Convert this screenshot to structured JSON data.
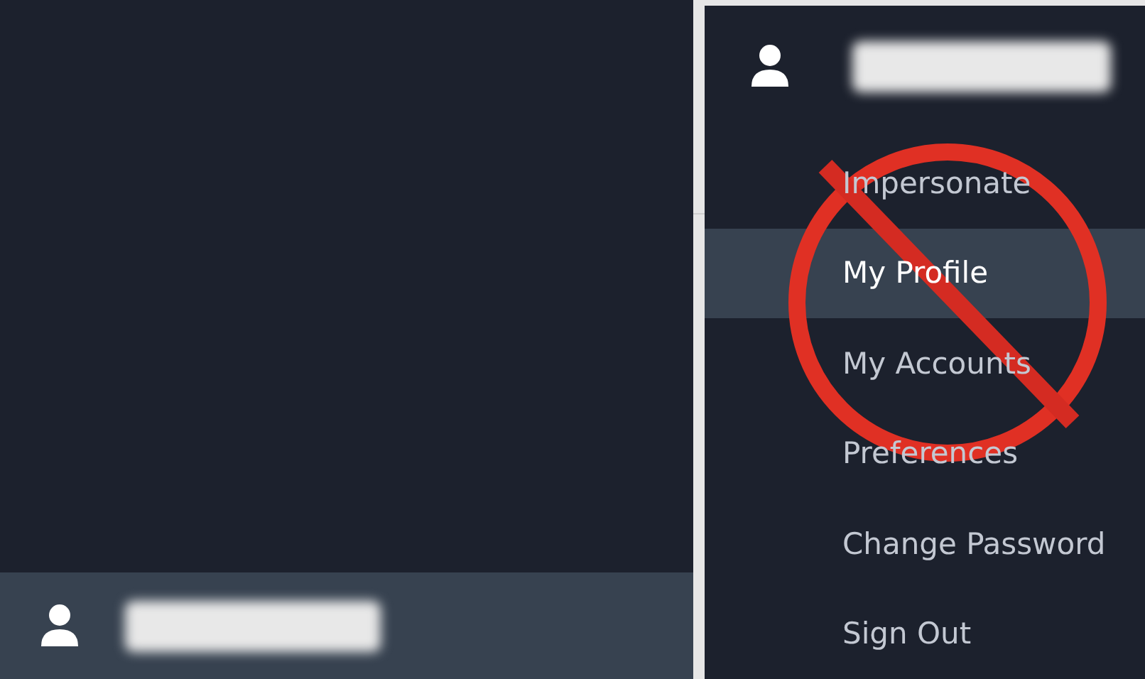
{
  "user_menu": {
    "items": [
      {
        "label": "Impersonate",
        "selected": false
      },
      {
        "label": "My Profile",
        "selected": true
      },
      {
        "label": "My Accounts",
        "selected": false
      },
      {
        "label": "Preferences",
        "selected": false
      },
      {
        "label": "Change Password",
        "selected": false
      },
      {
        "label": "Sign Out",
        "selected": false
      }
    ]
  }
}
